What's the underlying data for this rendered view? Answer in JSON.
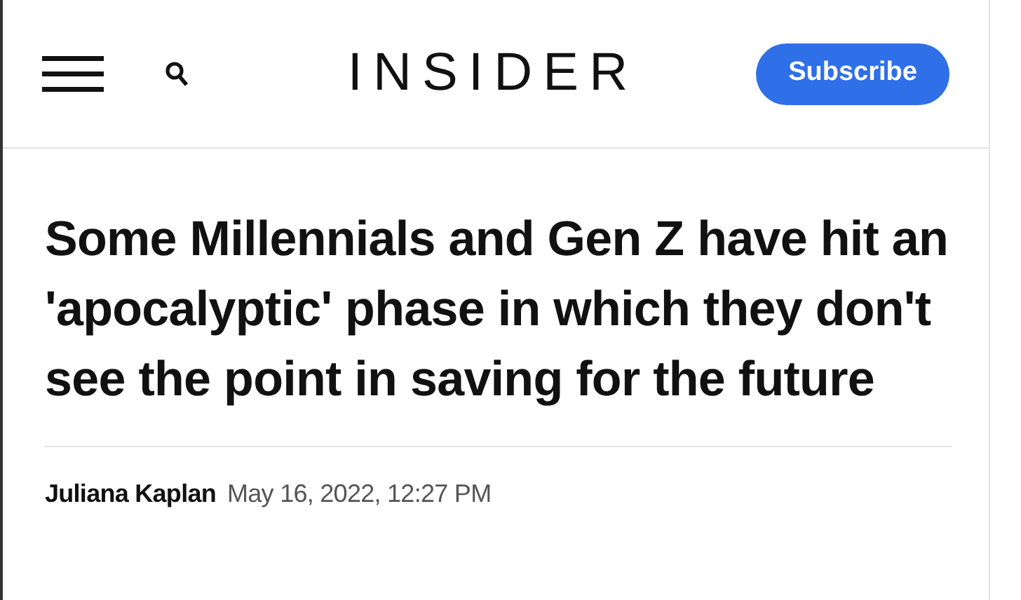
{
  "header": {
    "logo": "INSIDER",
    "subscribe_button": "Subscribe"
  },
  "article": {
    "headline": "Some Millennials and Gen Z have hit an 'apocalyptic' phase in which they don't see the point in saving for the future",
    "author": "Juliana Kaplan",
    "date": "May 16, 2022, 12:27 PM"
  }
}
